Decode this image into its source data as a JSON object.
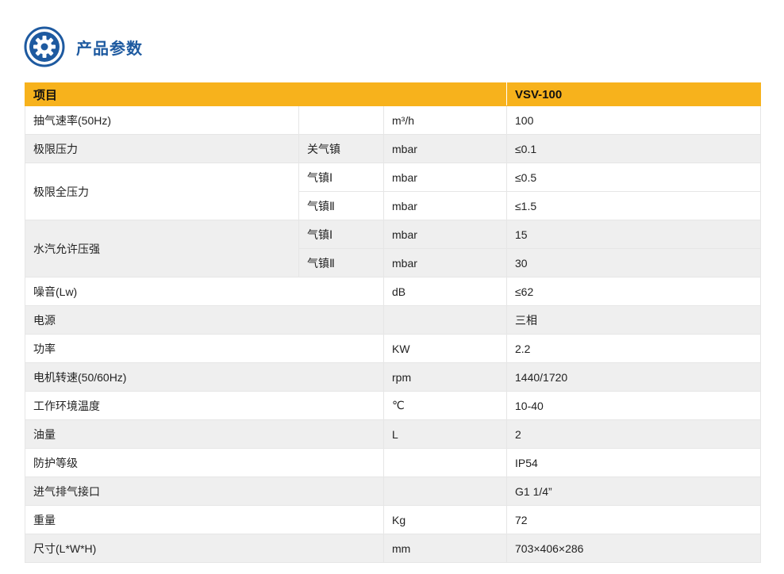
{
  "section": {
    "title": "产品参数",
    "icon": "gear-icon",
    "accent": "#1e5aa0"
  },
  "table": {
    "header_color": "#f7b21c",
    "headers": [
      "项目",
      "VSV-100"
    ],
    "rows": {
      "r1": {
        "item": "抽气速率(50Hz)",
        "sub": "",
        "unit": "m³/h",
        "value": "100"
      },
      "r2": {
        "item": "极限压力",
        "sub": "关气镇",
        "unit": "mbar",
        "value": "≤0.1"
      },
      "r3": {
        "item": "极限全压力",
        "sub": "气镇Ⅰ",
        "unit": "mbar",
        "value": "≤0.5"
      },
      "r4": {
        "sub": "气镇Ⅱ",
        "unit": "mbar",
        "value": "≤1.5"
      },
      "r5": {
        "item": "水汽允许压强",
        "sub": "气镇Ⅰ",
        "unit": "mbar",
        "value": "15"
      },
      "r6": {
        "sub": "气镇Ⅱ",
        "unit": "mbar",
        "value": "30"
      },
      "r7": {
        "item": "噪音(Lw)",
        "unit": "dB",
        "value": "≤62"
      },
      "r8": {
        "item": "电源",
        "unit": "",
        "value": "三相"
      },
      "r9": {
        "item": "功率",
        "unit": "KW",
        "value": "2.2"
      },
      "r10": {
        "item": "电机转速(50/60Hz)",
        "unit": "rpm",
        "value": "1440/1720"
      },
      "r11": {
        "item": "工作环境温度",
        "unit": "℃",
        "value": "10-40"
      },
      "r12": {
        "item": "油量",
        "unit": "L",
        "value": "2"
      },
      "r13": {
        "item": "防护等级",
        "unit": "",
        "value": "IP54"
      },
      "r14": {
        "item": "进气排气接口",
        "unit": "",
        "value": "G1 1/4”"
      },
      "r15": {
        "item": "重量",
        "unit": "Kg",
        "value": "72"
      },
      "r16": {
        "item": "尺寸(L*W*H)",
        "unit": "mm",
        "value": "703×406×286"
      }
    }
  }
}
